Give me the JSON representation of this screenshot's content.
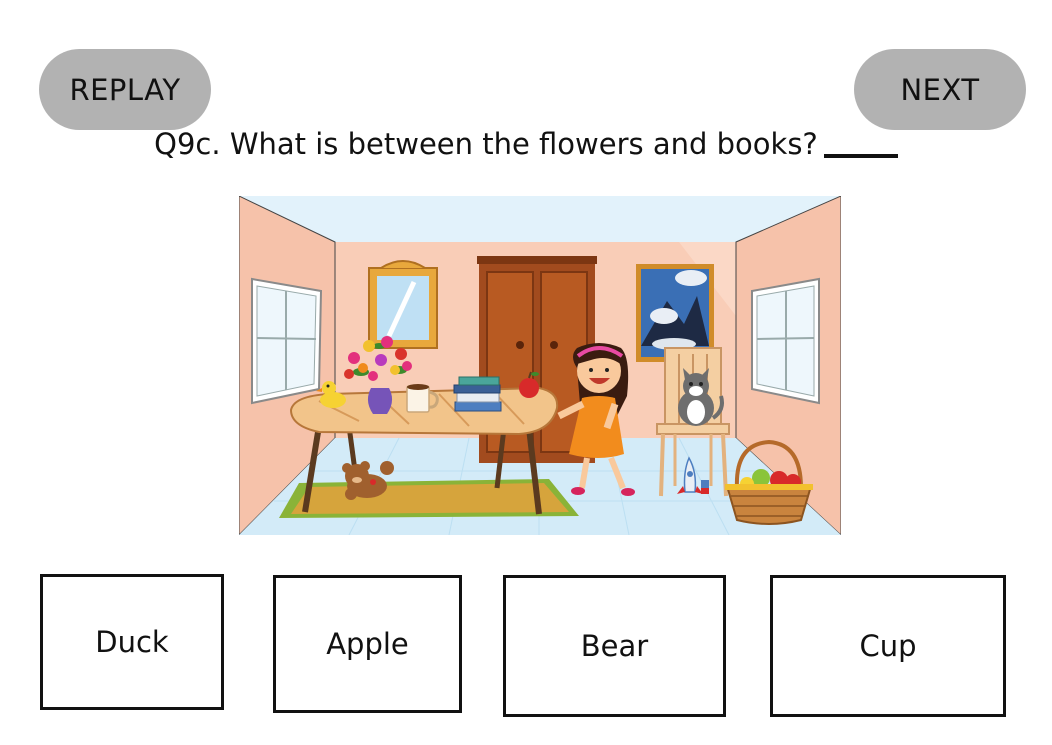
{
  "nav": {
    "replay_label": "REPLAY",
    "next_label": "NEXT"
  },
  "question": {
    "text": "Q9c. What is between the flowers and books?"
  },
  "options": [
    {
      "label": "Duck"
    },
    {
      "label": "Apple"
    },
    {
      "label": "Bear"
    },
    {
      "label": "Cup"
    }
  ],
  "colors": {
    "button_bg": "#b2b2b2",
    "wall": "#f6c5ae",
    "floor": "#cfe9f8",
    "girl_dress": "#f28c1d"
  },
  "scene": {
    "objects": [
      "mirror",
      "wardrobe",
      "mountain-painting",
      "window-left",
      "window-right",
      "table",
      "flowers-vase",
      "duck-toy",
      "cup",
      "books",
      "apple",
      "girl",
      "chair",
      "cat",
      "teddy-bear",
      "rug",
      "rocket-toy",
      "fruit-basket"
    ]
  }
}
